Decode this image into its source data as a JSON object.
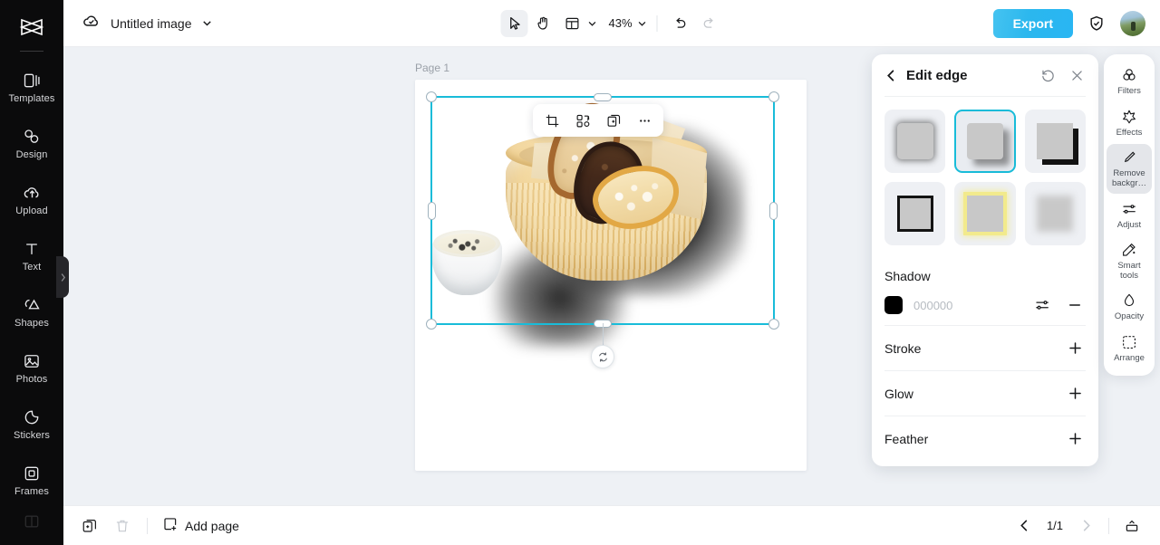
{
  "app": {
    "logo_icon": "capcut-logo-icon"
  },
  "sidebar": {
    "items": [
      {
        "label": "Templates",
        "icon": "templates-icon"
      },
      {
        "label": "Design",
        "icon": "design-icon"
      },
      {
        "label": "Upload",
        "icon": "upload-cloud-icon"
      },
      {
        "label": "Text",
        "icon": "text-icon"
      },
      {
        "label": "Shapes",
        "icon": "shapes-icon"
      },
      {
        "label": "Photos",
        "icon": "photos-icon"
      },
      {
        "label": "Stickers",
        "icon": "stickers-icon"
      },
      {
        "label": "Frames",
        "icon": "frames-icon"
      }
    ],
    "collapse_icon": "chevron-right-icon"
  },
  "topbar": {
    "cloud_status_icon": "cloud-saved-icon",
    "document_title": "Untitled image",
    "title_chevron_icon": "chevron-down-icon",
    "tools": {
      "select_icon": "cursor-select-icon",
      "hand_icon": "hand-pan-icon",
      "layout_icon": "layout-grid-icon",
      "layout_chevron_icon": "chevron-down-icon",
      "zoom_value": "43%",
      "zoom_chevron_icon": "chevron-down-icon",
      "undo_icon": "undo-icon",
      "redo_icon": "redo-icon"
    },
    "export_label": "Export",
    "shield_icon": "shield-check-icon",
    "avatar": "user-avatar"
  },
  "canvas": {
    "page_label": "Page 1",
    "element_toolbar": [
      {
        "name": "crop-button",
        "icon": "crop-icon"
      },
      {
        "name": "replace-button",
        "icon": "replace-media-icon"
      },
      {
        "name": "duplicate-button",
        "icon": "duplicate-icon"
      },
      {
        "name": "more-options-button",
        "icon": "ellipsis-icon"
      }
    ],
    "selection": {
      "rotate_icon": "rotate-handle-icon",
      "accent_color": "#19bcd9"
    },
    "image_alt": "bread-basket-photo"
  },
  "edit_panel": {
    "back_icon": "chevron-left-icon",
    "title": "Edit edge",
    "reset_icon": "reset-icon",
    "close_icon": "close-icon",
    "presets": [
      {
        "name": "soft-shadow-preset",
        "style": "soft",
        "selected": false
      },
      {
        "name": "drop-shadow-preset",
        "style": "drop",
        "selected": true
      },
      {
        "name": "hard-shadow-preset",
        "style": "hard",
        "selected": false
      },
      {
        "name": "stroke-preset",
        "style": "stroke",
        "selected": false
      },
      {
        "name": "glow-preset",
        "style": "glow",
        "selected": false
      },
      {
        "name": "feather-preset",
        "style": "feather",
        "selected": false
      }
    ],
    "shadow": {
      "label": "Shadow",
      "color_hex": "000000",
      "swatch_color": "#000000",
      "adjust_icon": "sliders-icon",
      "remove_icon": "minus-icon"
    },
    "rows": [
      {
        "label": "Stroke",
        "action_icon": "plus-icon"
      },
      {
        "label": "Glow",
        "action_icon": "plus-icon"
      },
      {
        "label": "Feather",
        "action_icon": "plus-icon"
      }
    ]
  },
  "right_rail": {
    "items": [
      {
        "label": "Filters",
        "icon": "filters-icon",
        "selected": false
      },
      {
        "label": "Effects",
        "icon": "effects-icon",
        "selected": false
      },
      {
        "label": "Remove backgr…",
        "icon": "remove-background-icon",
        "selected": true
      },
      {
        "label": "Adjust",
        "icon": "adjust-icon",
        "selected": false
      },
      {
        "label": "Smart tools",
        "icon": "smart-tools-icon",
        "selected": false
      },
      {
        "label": "Opacity",
        "icon": "opacity-icon",
        "selected": false
      },
      {
        "label": "Arrange",
        "icon": "arrange-icon",
        "selected": false
      }
    ]
  },
  "bottombar": {
    "duplicate_page_icon": "duplicate-page-icon",
    "delete_page_icon": "trash-icon",
    "add_page_label": "Add page",
    "add_page_icon": "add-page-icon",
    "prev_icon": "chevron-left-icon",
    "page_indicator": "1/1",
    "next_icon": "chevron-right-icon",
    "present_icon": "present-icon"
  }
}
